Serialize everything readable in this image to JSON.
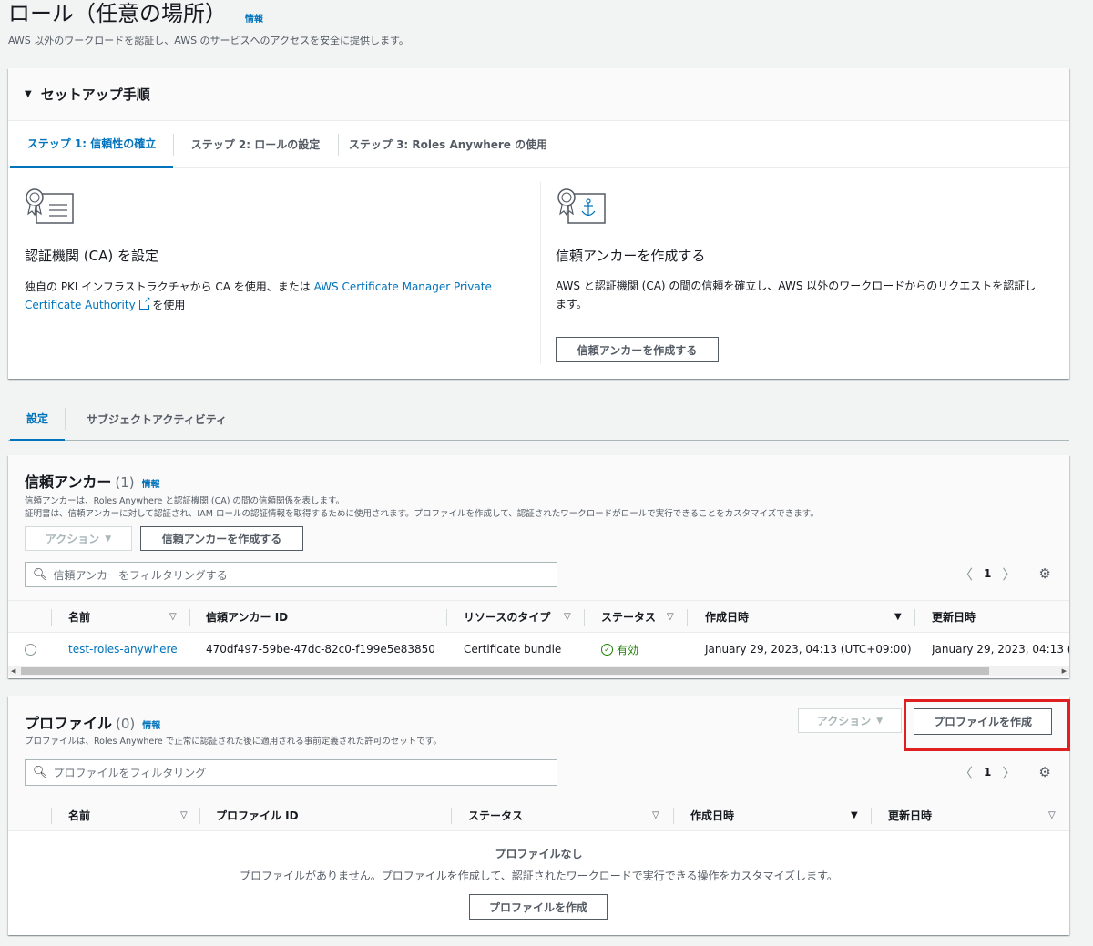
{
  "page": {
    "title": "ロール（任意の場所）",
    "info": "情報",
    "subtitle": "AWS 以外のワークロードを認証し、AWS のサービスへのアクセスを安全に提供します。"
  },
  "setup": {
    "header": "セットアップ手順",
    "tabs": [
      "ステップ 1: 信頼性の確立",
      "ステップ 2: ロールの設定",
      "ステップ 3: Roles Anywhere の使用"
    ],
    "left": {
      "title": "認証機関 (CA) を設定",
      "desc_prefix": "独自の PKI インフラストラクチャから CA を使用、または ",
      "link_line1": "AWS Certificate Manager Private",
      "link_line2": "Certificate Authority",
      "desc_suffix": " を使用"
    },
    "right": {
      "title": "信頼アンカーを作成する",
      "desc_line1": "AWS と認証機関 (CA) の間の信頼を確立し、AWS 以外のワークロードからのリクエストを認証し",
      "desc_line2": "ます。",
      "button": "信頼アンカーを作成する"
    }
  },
  "main_tabs": [
    "設定",
    "サブジェクトアクティビティ"
  ],
  "anchors": {
    "title": "信頼アンカー",
    "count": "(1)",
    "info": "情報",
    "desc1": "信頼アンカーは、Roles Anywhere と認証機関 (CA) の間の信頼関係を表します。",
    "desc2": "証明書は、信頼アンカーに対して認証され、IAM ロールの認証情報を取得するために使用されます。プロファイルを作成して、認証されたワークロードがロールで実行できることをカスタマイズできます。",
    "action": "アクション",
    "create": "信頼アンカーを作成する",
    "filter_placeholder": "信頼アンカーをフィルタリングする",
    "page": "1",
    "columns": [
      "名前",
      "信頼アンカー ID",
      "リソースのタイプ",
      "ステータス",
      "作成日時",
      "更新日時"
    ],
    "rows": [
      {
        "name": "test-roles-anywhere",
        "id": "470df497-59be-47dc-82c0-f199e5e83850",
        "type": "Certificate bundle",
        "status": "有効",
        "created": "January 29, 2023, 04:13 (UTC+09:00)",
        "updated": "January 29, 2023, 04:13 (U"
      }
    ]
  },
  "profiles": {
    "title": "プロファイル",
    "count": "(0)",
    "info": "情報",
    "desc": "プロファイルは、Roles Anywhere で正常に認証された後に適用される事前定義された許可のセットです。",
    "action": "アクション",
    "create": "プロファイルを作成",
    "filter_placeholder": "プロファイルをフィルタリング",
    "page": "1",
    "columns": [
      "名前",
      "プロファイル ID",
      "ステータス",
      "作成日時",
      "更新日時"
    ],
    "empty_title": "プロファイルなし",
    "empty_desc": "プロファイルがありません。プロファイルを作成して、認証されたワークロードで実行できる操作をカスタマイズします。",
    "empty_button": "プロファイルを作成"
  },
  "colors": {
    "link": "#0073bb",
    "success": "#1d8102",
    "highlight": "#e02020"
  }
}
